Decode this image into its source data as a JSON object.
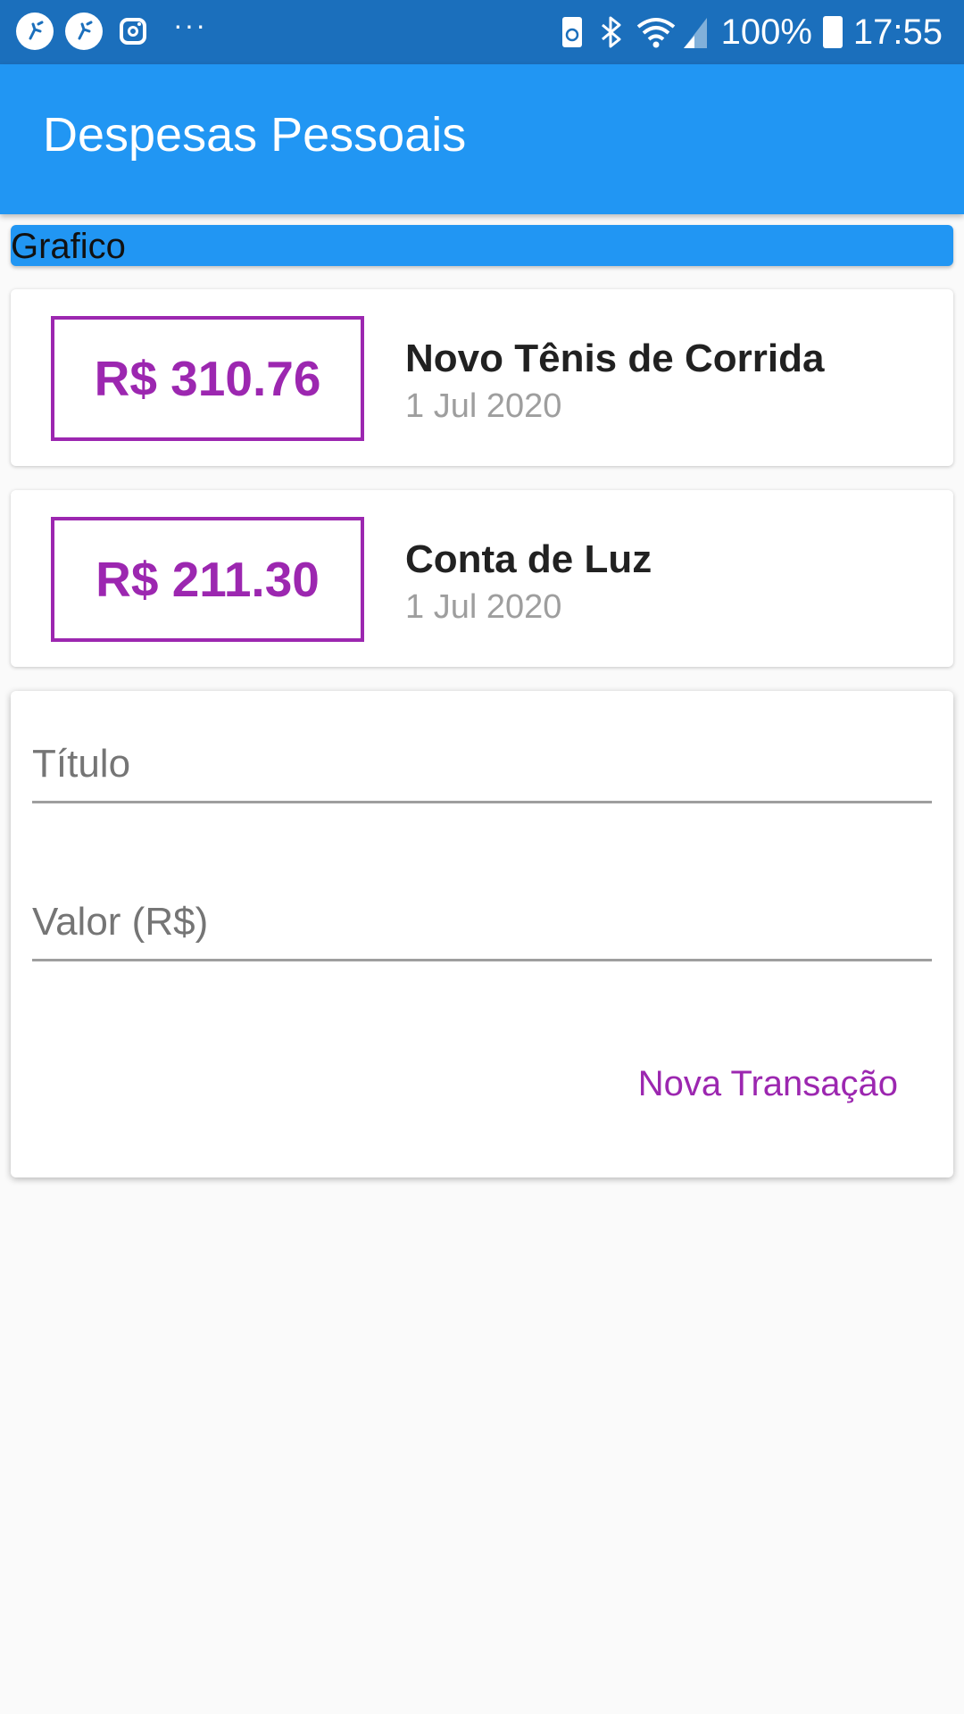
{
  "status_bar": {
    "battery": "100%",
    "time": "17:55",
    "more": "···",
    "icons": [
      "app-icon",
      "app-icon",
      "instagram-icon",
      "battery-saver-icon",
      "bluetooth-icon",
      "wifi-icon",
      "signal-icon",
      "battery-icon"
    ]
  },
  "app_bar": {
    "title": "Despesas Pessoais"
  },
  "chart": {
    "label": "Grafico"
  },
  "transactions": [
    {
      "value": "R$ 310.76",
      "title": "Novo Tênis de Corrida",
      "date": "1 Jul 2020"
    },
    {
      "value": "R$ 211.30",
      "title": "Conta de Luz",
      "date": "1 Jul 2020"
    }
  ],
  "form": {
    "title_placeholder": "Título",
    "value_placeholder": "Valor (R$)",
    "submit_label": "Nova Transação"
  },
  "colors": {
    "status_bar": "#1b6fbc",
    "app_bar": "#2196f3",
    "accent": "#9c27b0",
    "background": "#fafafa"
  }
}
